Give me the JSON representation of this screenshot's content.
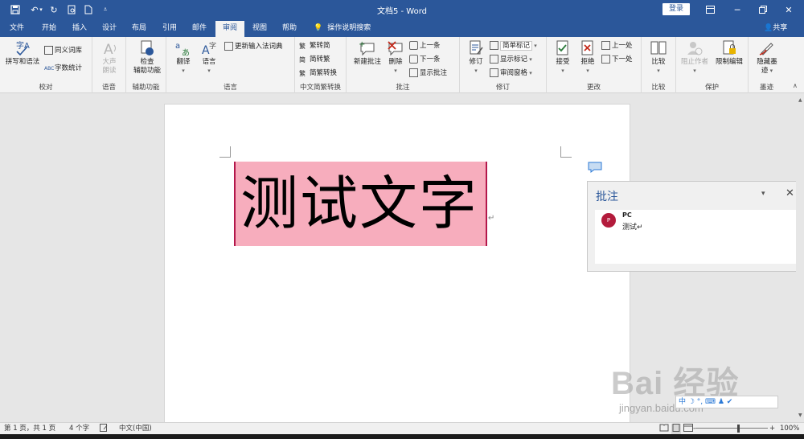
{
  "window": {
    "title": "文档5 - Word",
    "login_label": "登录"
  },
  "menu": {
    "tabs": [
      "文件",
      "开始",
      "插入",
      "设计",
      "布局",
      "引用",
      "邮件",
      "审阅",
      "视图",
      "帮助"
    ],
    "active_tab": "审阅",
    "tell_me": "操作说明搜索",
    "share": "共享"
  },
  "ribbon": {
    "proofing": {
      "label": "校对",
      "spelling": "拼写和语法",
      "thesaurus": "同义词库",
      "word_count": "字数统计"
    },
    "speech": {
      "label": "语音",
      "read_aloud_1": "大声",
      "read_aloud_2": "朗读"
    },
    "accessibility": {
      "label": "辅助功能",
      "check_1": "检查",
      "check_2": "辅助功能"
    },
    "language": {
      "label": "语言",
      "translate": "翻译",
      "language": "语言",
      "update_ime": "更新输入法词典"
    },
    "chinese": {
      "label": "中文简繁转换",
      "t2s": "繁转简",
      "s2t": "简转繁",
      "convert": "简繁转换"
    },
    "comments": {
      "label": "批注",
      "new": "新建批注",
      "delete": "删除",
      "previous": "上一条",
      "next": "下一条",
      "show": "显示批注"
    },
    "tracking": {
      "label": "修订",
      "track": "修订",
      "simple_markup": "简单标记",
      "show_markup": "显示标记",
      "review_pane": "审阅窗格"
    },
    "changes": {
      "label": "更改",
      "accept": "接受",
      "reject": "拒绝",
      "previous": "上一处",
      "next": "下一处"
    },
    "compare": {
      "label": "比较",
      "compare": "比较"
    },
    "protect": {
      "label": "保护",
      "block_authors": "阻止作者",
      "restrict": "限制编辑"
    },
    "ink": {
      "label": "墨迹",
      "hide_ink_1": "隐藏墨",
      "hide_ink_2": "迹"
    }
  },
  "document": {
    "text": "测试文字",
    "highlight_color": "#f7adbd"
  },
  "comment_pane": {
    "title": "批注",
    "author_initial": "P",
    "author": "PC",
    "body": "测试↵"
  },
  "status": {
    "page": "第 1 页，共 1 页",
    "words": "4 个字",
    "language": "中文(中国)",
    "zoom": "100%",
    "zoom_plus": "+",
    "zoom_minus": "-"
  },
  "watermark": {
    "brand": "Bai 经验",
    "url": "jingyan.baidu.com",
    "ime": "中 ☽ °, ⌨ ♟ ✔"
  },
  "colors": {
    "accent": "#2b579a",
    "author_avatar": "#b31b3c"
  }
}
